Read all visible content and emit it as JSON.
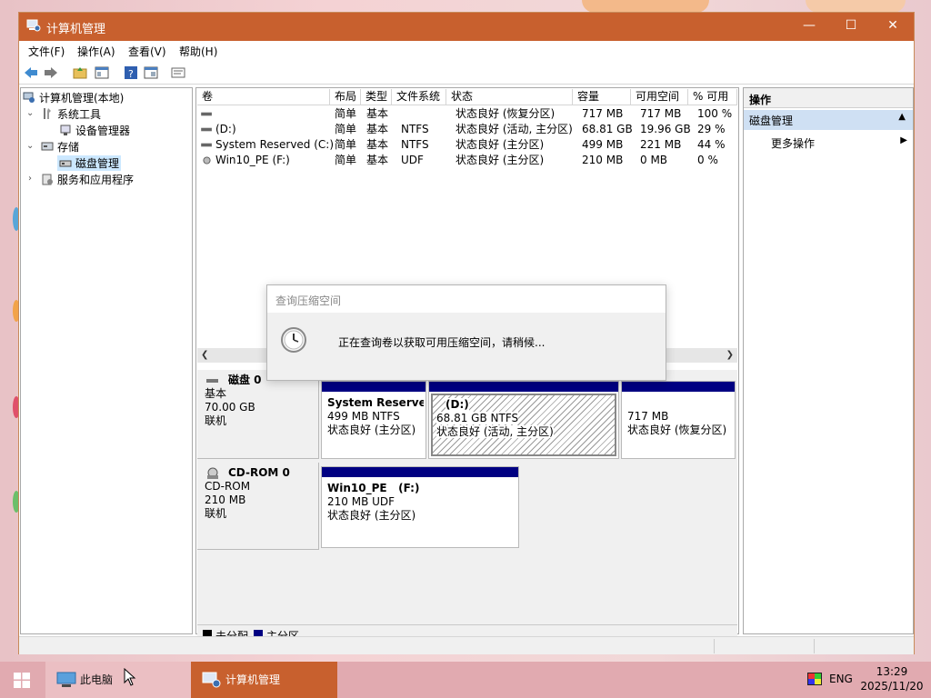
{
  "window": {
    "title": "计算机管理",
    "accent_color": "#c8602e"
  },
  "menu": [
    "文件(F)",
    "操作(A)",
    "查看(V)",
    "帮助(H)"
  ],
  "tree": {
    "root": "计算机管理(本地)",
    "system_tools": "系统工具",
    "device_manager": "设备管理器",
    "storage": "存储",
    "disk_management": "磁盘管理",
    "services": "服务和应用程序"
  },
  "volumes": {
    "columns": [
      "卷",
      "布局",
      "类型",
      "文件系统",
      "状态",
      "容量",
      "可用空间",
      "% 可用"
    ],
    "rows": [
      [
        "",
        "简单",
        "基本",
        "",
        "状态良好 (恢复分区)",
        "717 MB",
        "717 MB",
        "100 %"
      ],
      [
        "(D:)",
        "简单",
        "基本",
        "NTFS",
        "状态良好 (活动, 主分区)",
        "68.81 GB",
        "19.96 GB",
        "29 %"
      ],
      [
        "System Reserved (C:)",
        "简单",
        "基本",
        "NTFS",
        "状态良好 (主分区)",
        "499 MB",
        "221 MB",
        "44 %"
      ],
      [
        "Win10_PE (F:)",
        "简单",
        "基本",
        "UDF",
        "状态良好 (主分区)",
        "210 MB",
        "0 MB",
        "0 %"
      ]
    ]
  },
  "disks": [
    {
      "name": "磁盘 0",
      "type": "基本",
      "size": "70.00 GB",
      "state": "联机",
      "partitions": [
        {
          "title": "System Reserve",
          "size": "499 MB NTFS",
          "status": "状态良好 (主分区)"
        },
        {
          "title": "(D:)",
          "size": "68.81 GB NTFS",
          "status": "状态良好 (活动, 主分区)"
        },
        {
          "title": "",
          "size": "717 MB",
          "status": "状态良好 (恢复分区)"
        }
      ]
    },
    {
      "name": "CD-ROM 0",
      "type": "CD-ROM",
      "size": "210 MB",
      "state": "联机",
      "partitions": [
        {
          "title": "Win10_PE   (F:)",
          "size": "210 MB UDF",
          "status": "状态良好 (主分区)"
        }
      ]
    }
  ],
  "legend": {
    "unallocated": "未分配",
    "primary": "主分区",
    "primary_color": "#000082",
    "unallocated_color": "#000000"
  },
  "actions": {
    "header": "操作",
    "section": "磁盘管理",
    "more": "更多操作"
  },
  "dialog": {
    "title": "查询压缩空间",
    "message": "正在查询卷以获取可用压缩空间，请稍候..."
  },
  "taskbar": {
    "items": [
      "此电脑",
      "计算机管理"
    ],
    "lang": "ENG",
    "time": "13:29",
    "date": "2025/11/20"
  }
}
